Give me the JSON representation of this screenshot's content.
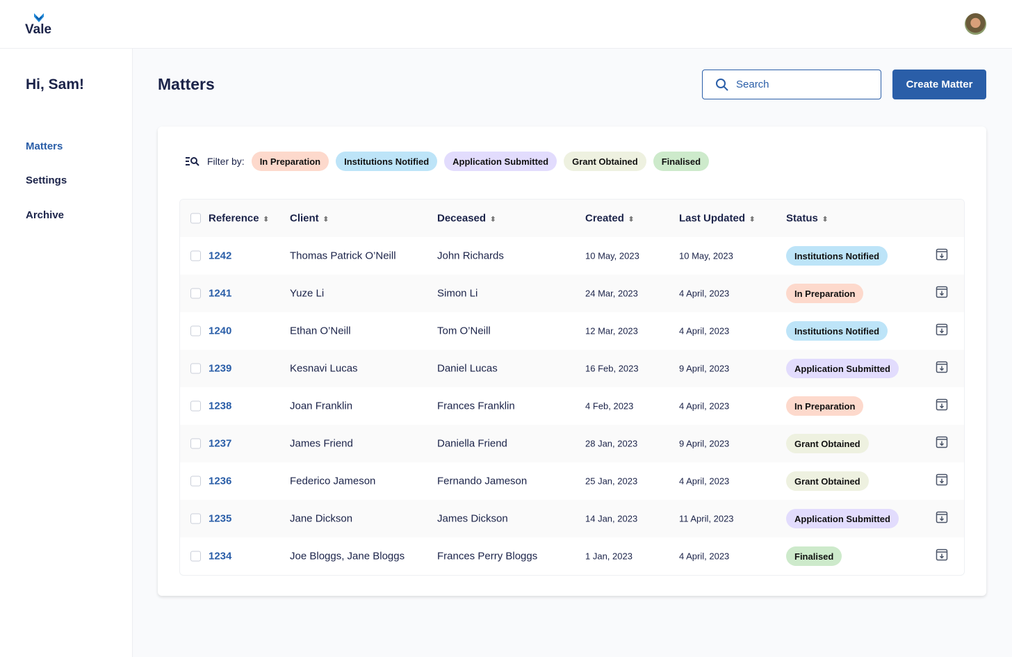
{
  "app": {
    "logo": "Vale"
  },
  "sidebar": {
    "greeting": "Hi, Sam!",
    "items": [
      {
        "label": "Matters",
        "active": true
      },
      {
        "label": "Settings"
      },
      {
        "label": "Archive"
      }
    ]
  },
  "page": {
    "title": "Matters",
    "search_placeholder": "Search",
    "create_label": "Create Matter"
  },
  "filter": {
    "label": "Filter by:",
    "chips": [
      {
        "label": "In Preparation",
        "color": "#fdd9cc"
      },
      {
        "label": "Institutions Notified",
        "color": "#bde4f8"
      },
      {
        "label": "Application Submitted",
        "color": "#e2dcfd"
      },
      {
        "label": "Grant Obtained",
        "color": "#eef1e0"
      },
      {
        "label": "Finalised",
        "color": "#cdeacb"
      }
    ]
  },
  "table": {
    "columns": [
      "Reference",
      "Client",
      "Deceased",
      "Created",
      "Last Updated",
      "Status"
    ],
    "rows": [
      {
        "ref": "1242",
        "client": "Thomas Patrick O’Neill",
        "deceased": "John Richards",
        "created": "10 May, 2023",
        "updated": "10 May, 2023",
        "status": "Institutions Notified"
      },
      {
        "ref": "1241",
        "client": "Yuze Li",
        "deceased": "Simon Li",
        "created": "24 Mar, 2023",
        "updated": "4 April, 2023",
        "status": "In Preparation"
      },
      {
        "ref": "1240",
        "client": "Ethan O’Neill",
        "deceased": "Tom O’Neill",
        "created": "12 Mar, 2023",
        "updated": "4 April, 2023",
        "status": "Institutions Notified"
      },
      {
        "ref": "1239",
        "client": "Kesnavi Lucas",
        "deceased": "Daniel Lucas",
        "created": "16 Feb, 2023",
        "updated": "9 April, 2023",
        "status": "Application Submitted"
      },
      {
        "ref": "1238",
        "client": "Joan Franklin",
        "deceased": "Frances Franklin",
        "created": "4 Feb, 2023",
        "updated": "4 April, 2023",
        "status": "In Preparation"
      },
      {
        "ref": "1237",
        "client": "James Friend",
        "deceased": "Daniella Friend",
        "created": "28 Jan, 2023",
        "updated": "9 April, 2023",
        "status": "Grant Obtained"
      },
      {
        "ref": "1236",
        "client": "Federico Jameson",
        "deceased": "Fernando Jameson",
        "created": "25 Jan, 2023",
        "updated": "4 April, 2023",
        "status": "Grant Obtained"
      },
      {
        "ref": "1235",
        "client": "Jane Dickson",
        "deceased": "James Dickson",
        "created": "14 Jan, 2023",
        "updated": "11 April, 2023",
        "status": "Application Submitted"
      },
      {
        "ref": "1234",
        "client": "Joe Bloggs, Jane Bloggs",
        "deceased": "Frances Perry Bloggs",
        "created": "1 Jan, 2023",
        "updated": "4 April, 2023",
        "status": "Finalised"
      }
    ]
  }
}
